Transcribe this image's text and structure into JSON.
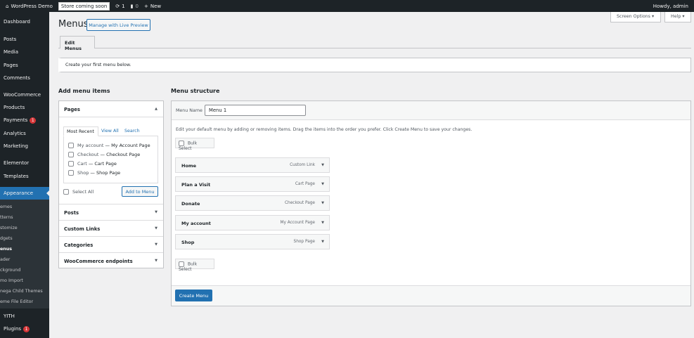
{
  "adminbar": {
    "site": "WordPress Demo",
    "store_badge": "Store coming soon",
    "updates": "1",
    "comments": "0",
    "new": "New",
    "howdy": "Howdy, admin"
  },
  "sidebar": {
    "items": [
      "Dashboard",
      "Posts",
      "Media",
      "Pages",
      "Comments",
      "WooCommerce",
      "Products",
      "Payments",
      "Analytics",
      "Marketing",
      "Elementor",
      "Templates",
      "Appearance"
    ],
    "payments_badge": "1",
    "submenu": [
      "emes",
      "tterns",
      "stomize",
      "dgets",
      "enus",
      "ader",
      "ckground",
      "mo Import",
      "nega Child Themes",
      "eme File Editor"
    ],
    "after": [
      "YITH",
      "Plugins"
    ],
    "plugins_badge": "1"
  },
  "header": {
    "title": "Menus",
    "live_preview": "Manage with Live Preview",
    "screen_options": "Screen Options",
    "help": "Help",
    "tab": "Edit Menus"
  },
  "notice": "Create your first menu below.",
  "add_items": {
    "heading": "Add menu items",
    "pages_title": "Pages",
    "tabs": [
      "Most Recent",
      "View All",
      "Search"
    ],
    "pages": [
      {
        "name": "My account",
        "page": "My Account Page"
      },
      {
        "name": "Checkout",
        "page": "Checkout Page"
      },
      {
        "name": "Cart",
        "page": "Cart Page"
      },
      {
        "name": "Shop",
        "page": "Shop Page"
      }
    ],
    "select_all": "Select All",
    "add_button": "Add to Menu",
    "sections": [
      "Posts",
      "Custom Links",
      "Categories",
      "WooCommerce endpoints"
    ]
  },
  "structure": {
    "heading": "Menu structure",
    "menu_name_label": "Menu Name",
    "menu_name": "Menu 1",
    "description": "Edit your default menu by adding or removing items. Drag the items into the order you prefer. Click Create Menu to save your changes.",
    "bulk_select": "Bulk Select",
    "items": [
      {
        "title": "Home",
        "type": "Custom Link"
      },
      {
        "title": "Plan a Visit",
        "type": "Cart Page"
      },
      {
        "title": "Donate",
        "type": "Checkout Page"
      },
      {
        "title": "My account",
        "type": "My Account Page"
      },
      {
        "title": "Shop",
        "type": "Shop Page"
      }
    ],
    "create_button": "Create Menu"
  },
  "colors": {
    "accent": "#2271b1",
    "sidebar": "#1d2327",
    "badge": "#d63638"
  }
}
